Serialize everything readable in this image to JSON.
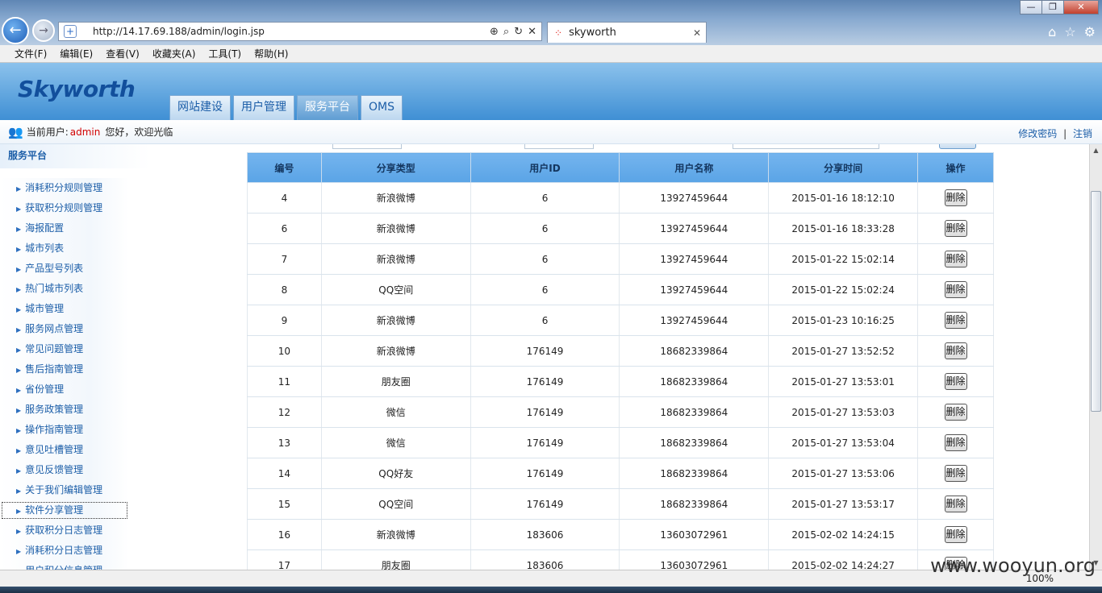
{
  "browser": {
    "url": "http://14.17.69.188/admin/login.jsp",
    "tab_title": "skyworth",
    "zoom": "100%",
    "menu": [
      "文件(F)",
      "编辑(E)",
      "查看(V)",
      "收藏夹(A)",
      "工具(T)",
      "帮助(H)"
    ]
  },
  "app": {
    "logo": "Skyworth",
    "tabs": [
      "网站建设",
      "用户管理",
      "服务平台",
      "OMS"
    ],
    "active_tab": "服务平台"
  },
  "user": {
    "label": "当前用户:",
    "name": "admin",
    "greeting": "您好，欢迎光临",
    "change_password": "修改密码",
    "separator": "|",
    "logout": "注销"
  },
  "sidebar": {
    "title": "服务平台",
    "items": [
      "消耗积分规则管理",
      "获取积分规则管理",
      "海报配置",
      "城市列表",
      "产品型号列表",
      "热门城市列表",
      "城市管理",
      "服务网点管理",
      "常见问题管理",
      "售后指南管理",
      "省份管理",
      "服务政策管理",
      "操作指南管理",
      "意见吐槽管理",
      "意见反馈管理",
      "关于我们编辑管理",
      "软件分享管理",
      "获取积分日志管理",
      "消耗积分日志管理",
      "用户积分信息管理"
    ],
    "active_index": 16
  },
  "table": {
    "headers": [
      "编号",
      "分享类型",
      "用户ID",
      "用户名称",
      "分享时间",
      "操作"
    ],
    "delete_label": "删除",
    "rows": [
      [
        "4",
        "新浪微博",
        "6",
        "13927459644",
        "2015-01-16 18:12:10"
      ],
      [
        "6",
        "新浪微博",
        "6",
        "13927459644",
        "2015-01-16 18:33:28"
      ],
      [
        "7",
        "新浪微博",
        "6",
        "13927459644",
        "2015-01-22 15:02:14"
      ],
      [
        "8",
        "QQ空间",
        "6",
        "13927459644",
        "2015-01-22 15:02:24"
      ],
      [
        "9",
        "新浪微博",
        "6",
        "13927459644",
        "2015-01-23 10:16:25"
      ],
      [
        "10",
        "新浪微博",
        "176149",
        "18682339864",
        "2015-01-27 13:52:52"
      ],
      [
        "11",
        "朋友圈",
        "176149",
        "18682339864",
        "2015-01-27 13:53:01"
      ],
      [
        "12",
        "微信",
        "176149",
        "18682339864",
        "2015-01-27 13:53:03"
      ],
      [
        "13",
        "微信",
        "176149",
        "18682339864",
        "2015-01-27 13:53:04"
      ],
      [
        "14",
        "QQ好友",
        "176149",
        "18682339864",
        "2015-01-27 13:53:06"
      ],
      [
        "15",
        "QQ空间",
        "176149",
        "18682339864",
        "2015-01-27 13:53:17"
      ],
      [
        "16",
        "新浪微博",
        "183606",
        "13603072961",
        "2015-02-02 14:24:15"
      ],
      [
        "17",
        "朋友圈",
        "183606",
        "13603072961",
        "2015-02-02 14:24:27"
      ]
    ]
  },
  "watermark": "www.wooyun.org"
}
